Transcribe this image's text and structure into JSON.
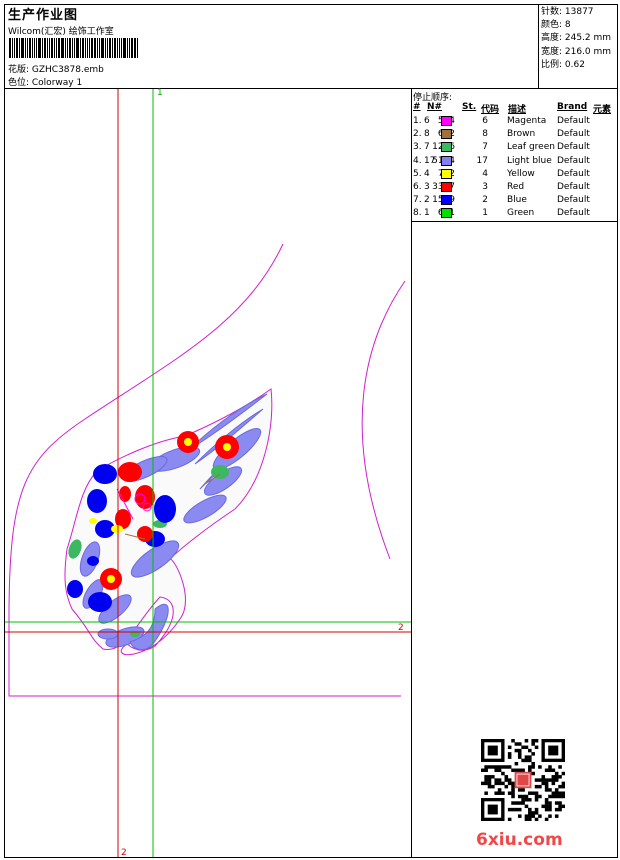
{
  "header": {
    "title": "生产作业图",
    "subtitle": "Wilcom(汇宏) 绘饰工作室",
    "design_file": "花版: GZHC3878.emb",
    "colorway": "色位: Colorway 1"
  },
  "stats": {
    "stitches": "针数: 13877",
    "colors": "颜色: 8",
    "height": "高度: 245.2 mm",
    "width": "宽度: 216.0 mm",
    "scale": "比例: 0.62"
  },
  "stop_sequence": {
    "title": "停止顺序:",
    "headers": [
      "#",
      "N#",
      "St.",
      "代码",
      "描述",
      "Brand",
      "元素"
    ],
    "rows": [
      {
        "index": "1.",
        "n": "6",
        "color": "#ff00ff",
        "stitches": "564",
        "code": "6",
        "desc": "Magenta",
        "brand": "Default"
      },
      {
        "index": "2.",
        "n": "8",
        "color": "#a0703a",
        "stitches": "652",
        "code": "8",
        "desc": "Brown",
        "brand": "Default"
      },
      {
        "index": "3.",
        "n": "7",
        "color": "#3cb860",
        "stitches": "1216",
        "code": "7",
        "desc": "Leaf green",
        "brand": "Default"
      },
      {
        "index": "4.",
        "n": "17",
        "color": "#8080f0",
        "stitches": "5164",
        "code": "17",
        "desc": "Light blue",
        "brand": "Default"
      },
      {
        "index": "5.",
        "n": "4",
        "color": "#ffff00",
        "stitches": "762",
        "code": "4",
        "desc": "Yellow",
        "brand": "Default"
      },
      {
        "index": "6.",
        "n": "3",
        "color": "#ff0000",
        "stitches": "3337",
        "code": "3",
        "desc": "Red",
        "brand": "Default"
      },
      {
        "index": "7.",
        "n": "2",
        "color": "#0000ff",
        "stitches": "1549",
        "code": "2",
        "desc": "Blue",
        "brand": "Default"
      },
      {
        "index": "8.",
        "n": "1",
        "color": "#00e000",
        "stitches": "631",
        "code": "1",
        "desc": "Green",
        "brand": "Default"
      }
    ]
  },
  "guides": {
    "green_top": "1",
    "red_right": "2",
    "red_bottom": "2"
  },
  "watermark": "6xiu.com",
  "colors": {
    "guide_red": "#d40000",
    "guide_green": "#00c000",
    "outline": "#d020d0"
  }
}
